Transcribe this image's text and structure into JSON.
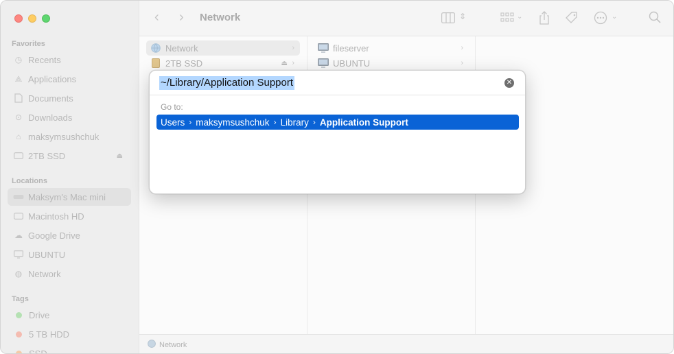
{
  "sidebar": {
    "favorites_header": "Favorites",
    "favorites": [
      {
        "label": "Recents",
        "icon": "clock-icon"
      },
      {
        "label": "Applications",
        "icon": "applications-icon"
      },
      {
        "label": "Documents",
        "icon": "document-icon"
      },
      {
        "label": "Downloads",
        "icon": "download-icon"
      },
      {
        "label": "maksymsushchuk",
        "icon": "home-icon"
      },
      {
        "label": "2TB SSD",
        "icon": "drive-icon"
      }
    ],
    "locations_header": "Locations",
    "locations": [
      {
        "label": "Maksym's Mac mini",
        "icon": "computer-icon"
      },
      {
        "label": "Macintosh HD",
        "icon": "drive-icon"
      },
      {
        "label": "Google Drive",
        "icon": "cloud-icon"
      },
      {
        "label": "UBUNTU",
        "icon": "monitor-icon"
      },
      {
        "label": "Network",
        "icon": "globe-icon"
      }
    ],
    "tags_header": "Tags",
    "tags": [
      {
        "label": "Drive",
        "color": "#7fd07a"
      },
      {
        "label": "5 TB HDD",
        "color": "#f0907e"
      },
      {
        "label": "SSD",
        "color": "#f3a86a"
      }
    ]
  },
  "toolbar": {
    "title": "Network"
  },
  "columns": {
    "col1": [
      {
        "label": "Network"
      },
      {
        "label": "2TB SSD"
      }
    ],
    "col2": [
      {
        "label": "fileserver"
      },
      {
        "label": "UBUNTU"
      }
    ]
  },
  "pathbar": {
    "label": "Network"
  },
  "dialog": {
    "input_value": "~/Library/Application Support",
    "goto_label": "Go to:",
    "result_parts": [
      "Users",
      "maksymsushchuk",
      "Library",
      "Application Support"
    ],
    "accent": "#0a63d6"
  }
}
